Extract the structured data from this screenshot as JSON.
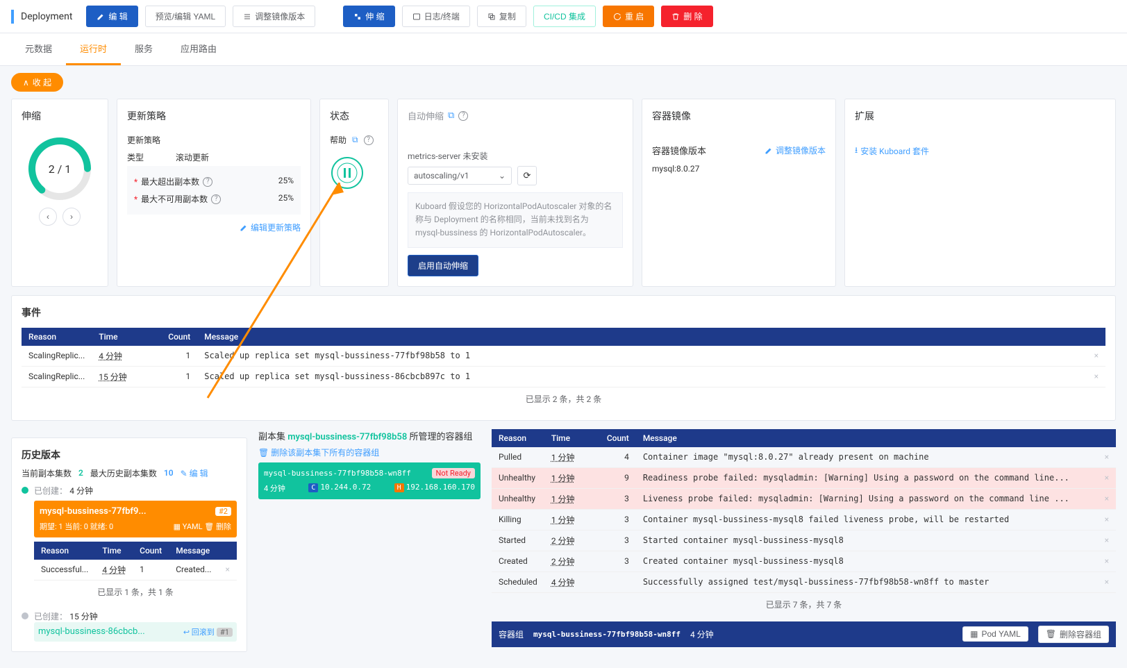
{
  "header": {
    "title": "Deployment",
    "buttons": {
      "edit": "编 辑",
      "yaml": "预览/编辑 YAML",
      "adjust_image": "调整镜像版本",
      "scale": "伸 缩",
      "logs": "日志/终端",
      "copy": "复制",
      "cicd": "CI/CD 集成",
      "restart": "重 启",
      "delete": "删 除"
    }
  },
  "tabs": {
    "meta": "元数据",
    "runtime": "运行时",
    "services": "服务",
    "routes": "应用路由"
  },
  "collapse": "收 起",
  "cards": {
    "scale": {
      "title": "伸缩",
      "ratio": "2 / 1"
    },
    "update": {
      "title": "更新策略",
      "subtitle": "更新策略",
      "type_label": "类型",
      "type_value": "滚动更新",
      "max_surge_label": "最大超出副本数",
      "max_surge_value": "25%",
      "max_unavail_label": "最大不可用副本数",
      "max_unavail_value": "25%",
      "edit_link": "编辑更新策略"
    },
    "state": {
      "title": "状态",
      "help": "帮助"
    },
    "auto": {
      "title": "自动伸缩",
      "not_installed": "metrics-server 未安装",
      "select": "autoscaling/v1",
      "note": "Kuboard 假设您的 HorizontalPodAutoscaler 对象的名称与 Deployment 的名称相同，当前未找到名为 mysql-bussiness 的 HorizontalPodAutoscaler。",
      "enable_btn": "启用自动伸缩"
    },
    "image": {
      "title": "容器镜像",
      "subtitle": "容器镜像版本",
      "adjust_link": "调整镜像版本",
      "value": "mysql:8.0.27"
    },
    "ext": {
      "title": "扩展",
      "install_link": "安装 Kuboard 套件"
    }
  },
  "events": {
    "title": "事件",
    "cols": {
      "reason": "Reason",
      "time": "Time",
      "count": "Count",
      "message": "Message"
    },
    "rows": [
      {
        "reason": "ScalingReplic...",
        "time": "4 分钟",
        "count": "1",
        "msg": "Scaled up replica set mysql-bussiness-77fbf98b58 to 1"
      },
      {
        "reason": "ScalingReplic...",
        "time": "15 分钟",
        "count": "1",
        "msg": "Scaled up replica set mysql-bussiness-86cbcb897c to 1"
      }
    ],
    "footer": "已显示 2 条，共 2 条"
  },
  "history": {
    "title": "历史版本",
    "current_label": "当前副本集数",
    "current_val": "2",
    "max_label": "最大历史副本集数",
    "max_val": "10",
    "edit": "编 辑",
    "created": "已创建：",
    "item1": {
      "time": "4 分钟",
      "name": "mysql-bussiness-77fbf9...",
      "badge": "#2",
      "desire": "期望: 1 当前: 0 就绪: 0",
      "yaml": "YAML",
      "delete": "删除"
    },
    "sub_table": {
      "cols": {
        "reason": "Reason",
        "time": "Time",
        "count": "Count",
        "message": "Message"
      },
      "row": {
        "reason": "Successful...",
        "time": "4 分钟",
        "count": "1",
        "msg": "Created..."
      },
      "footer": "已显示 1 条，共 1 条"
    },
    "item2": {
      "time": "15 分钟",
      "name": "mysql-bussiness-86cbcb...",
      "rollback": "回滚到",
      "badge": "#1"
    }
  },
  "replica": {
    "title_prefix": "副本集 ",
    "title_name": "mysql-bussiness-77fbf98b58",
    "title_suffix": " 所管理的容器组",
    "delete_link": "删除该副本集下所有的容器组",
    "pod_name": "mysql-bussiness-77fbf98b58-wn8ff",
    "not_ready": "Not Ready",
    "age": "4 分钟",
    "ip_c": "10.244.0.72",
    "ip_h": "192.168.160.170"
  },
  "right_events": {
    "cols": {
      "reason": "Reason",
      "time": "Time",
      "count": "Count",
      "message": "Message"
    },
    "rows": [
      {
        "reason": "Pulled",
        "time": "1 分钟",
        "count": "4",
        "msg": "Container image \"mysql:8.0.27\" already present on machine",
        "cls": ""
      },
      {
        "reason": "Unhealthy",
        "time": "1 分钟",
        "count": "9",
        "msg": "Readiness probe failed: mysqladmin: [Warning] Using a password on the command line...",
        "cls": "unhealthy-row"
      },
      {
        "reason": "Unhealthy",
        "time": "1 分钟",
        "count": "3",
        "msg": "Liveness probe failed: mysqladmin: [Warning] Using a password on the command line ...",
        "cls": "unhealthy-row"
      },
      {
        "reason": "Killing",
        "time": "1 分钟",
        "count": "3",
        "msg": "Container mysql-bussiness-mysql8 failed liveness probe, will be restarted",
        "cls": ""
      },
      {
        "reason": "Started",
        "time": "2 分钟",
        "count": "3",
        "msg": "Started container mysql-bussiness-mysql8",
        "cls": ""
      },
      {
        "reason": "Created",
        "time": "2 分钟",
        "count": "3",
        "msg": "Created container mysql-bussiness-mysql8",
        "cls": ""
      },
      {
        "reason": "Scheduled",
        "time": "4 分钟",
        "count": "",
        "msg": "Successfully assigned test/mysql-bussiness-77fbf98b58-wn8ff to master",
        "cls": ""
      }
    ],
    "footer": "已显示 7 条，共 7 条"
  },
  "pod_bar": {
    "label": "容器组",
    "name": "mysql-bussiness-77fbf98b58-wn8ff",
    "age": "4 分钟",
    "yaml_btn": "Pod YAML",
    "delete_btn": "删除容器组"
  }
}
